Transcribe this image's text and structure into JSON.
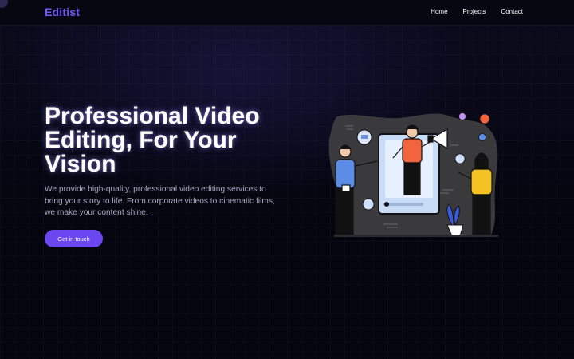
{
  "navbar": {
    "brand": "Editist",
    "links": [
      {
        "label": "Home"
      },
      {
        "label": "Projects"
      },
      {
        "label": "Contact"
      }
    ]
  },
  "hero": {
    "title": "Professional Video Editing, For Your Vision",
    "description": "We provide high-quality, professional video editing services to bring your story to life. From corporate videos to cinematic films, we make your content shine.",
    "cta_label": "Get in touch"
  },
  "colors": {
    "background": "#05050f",
    "accent": "#6a47f0",
    "brand": "#7357ff",
    "illustration_blob": "#3a3a3d"
  },
  "illustration": {
    "icons": [
      "chat-bubble-icon",
      "megaphone-icon",
      "user-icon",
      "heart-icon",
      "chat-icon",
      "plant-icon"
    ]
  }
}
